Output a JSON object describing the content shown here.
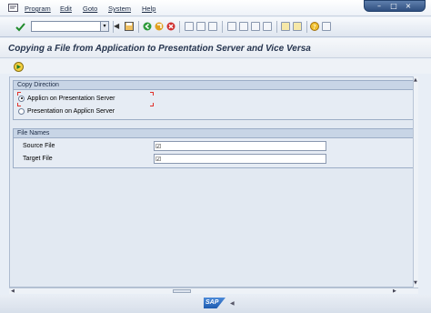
{
  "menubar": {
    "items": [
      "Program",
      "Edit",
      "Goto",
      "System",
      "Help"
    ]
  },
  "toolbar": {
    "command_value": ""
  },
  "title": "Copying a File from Application to Presentation Server and Vice Versa",
  "copy_direction": {
    "heading": "Copy Direction",
    "options": [
      {
        "label": "Applicn on Presentation Server",
        "selected": true
      },
      {
        "label": "Presentation on Applicn Server",
        "selected": false
      }
    ]
  },
  "file_names": {
    "heading": "File Names",
    "source_label": "Source File",
    "source_value": "",
    "target_label": "Target File",
    "target_value": ""
  },
  "status": {
    "logo_text": "SAP"
  },
  "colors": {
    "title_text": "#26354f",
    "group_header": "#c8d5e6",
    "accent": "#2f4f80"
  }
}
